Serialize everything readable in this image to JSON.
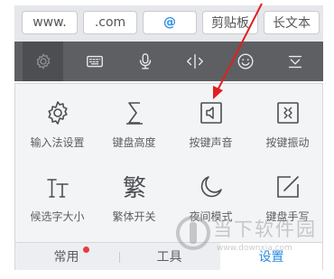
{
  "quick_bar": {
    "www": "www.",
    "com": ".com",
    "at": "@",
    "clipboard": "剪贴板",
    "long_text": "长文本"
  },
  "toolbar": {
    "items": [
      "gear-icon",
      "keyboard-icon",
      "microphone-icon",
      "cursor-move-icon",
      "emoji-icon",
      "collapse-icon"
    ]
  },
  "settings_grid": {
    "items": [
      {
        "label": "输入法设置",
        "icon": "gear-icon"
      },
      {
        "label": "键盘高度",
        "icon": "sigma-height-icon"
      },
      {
        "label": "按键声音",
        "icon": "speaker-icon"
      },
      {
        "label": "按键振动",
        "icon": "vibrate-icon"
      },
      {
        "label": "候选字大小",
        "icon": "font-size-icon"
      },
      {
        "label": "繁体开关",
        "icon": "traditional-char-icon",
        "glyph": "繁"
      },
      {
        "label": "夜间模式",
        "icon": "moon-icon"
      },
      {
        "label": "键盘手写",
        "icon": "handwriting-icon"
      }
    ]
  },
  "tabs": {
    "common": "常用",
    "tools": "工具",
    "settings": "设置"
  },
  "watermark": {
    "text": "当下软件园",
    "url": "www.downxia.com"
  },
  "colors": {
    "accent": "#2a8de0",
    "toolbar_bg": "#5d5f63",
    "annotation_arrow": "#e02020",
    "badge_dot": "#e83c3c"
  }
}
